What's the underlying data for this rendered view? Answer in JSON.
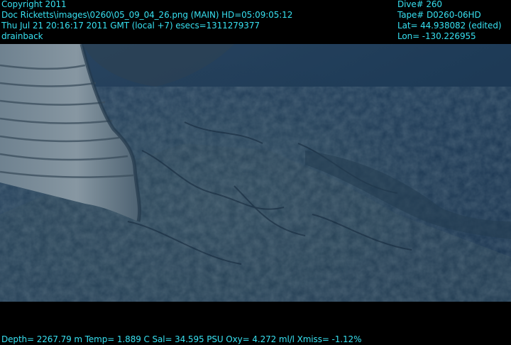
{
  "header": {
    "left_lines": [
      "Copyright 2011",
      "Doc Ricketts\\images\\0260\\05_09_04_26.png (MAIN)  HD=05:09:05:12",
      "Thu Jul 21 20:16:17 2011 GMT (local +7)  esecs=1311279377",
      "drainback"
    ],
    "right_lines": [
      "Dive# 260",
      "Tape# D0260-06HD",
      "Lat= 44.938082 (edited)",
      "Lon= -130.226955"
    ]
  },
  "footer": {
    "sensor_line": "Depth= 2267.79 m  Temp= 1.889 C  Sal= 34.595 PSU  Oxy= 4.272 ml/l  Xmiss= -1.12%"
  },
  "colors": {
    "overlay_text": "#37e0f0",
    "letterbox": "#000000",
    "water": "#1d3a55",
    "rock_light": "#7a8c9a"
  }
}
